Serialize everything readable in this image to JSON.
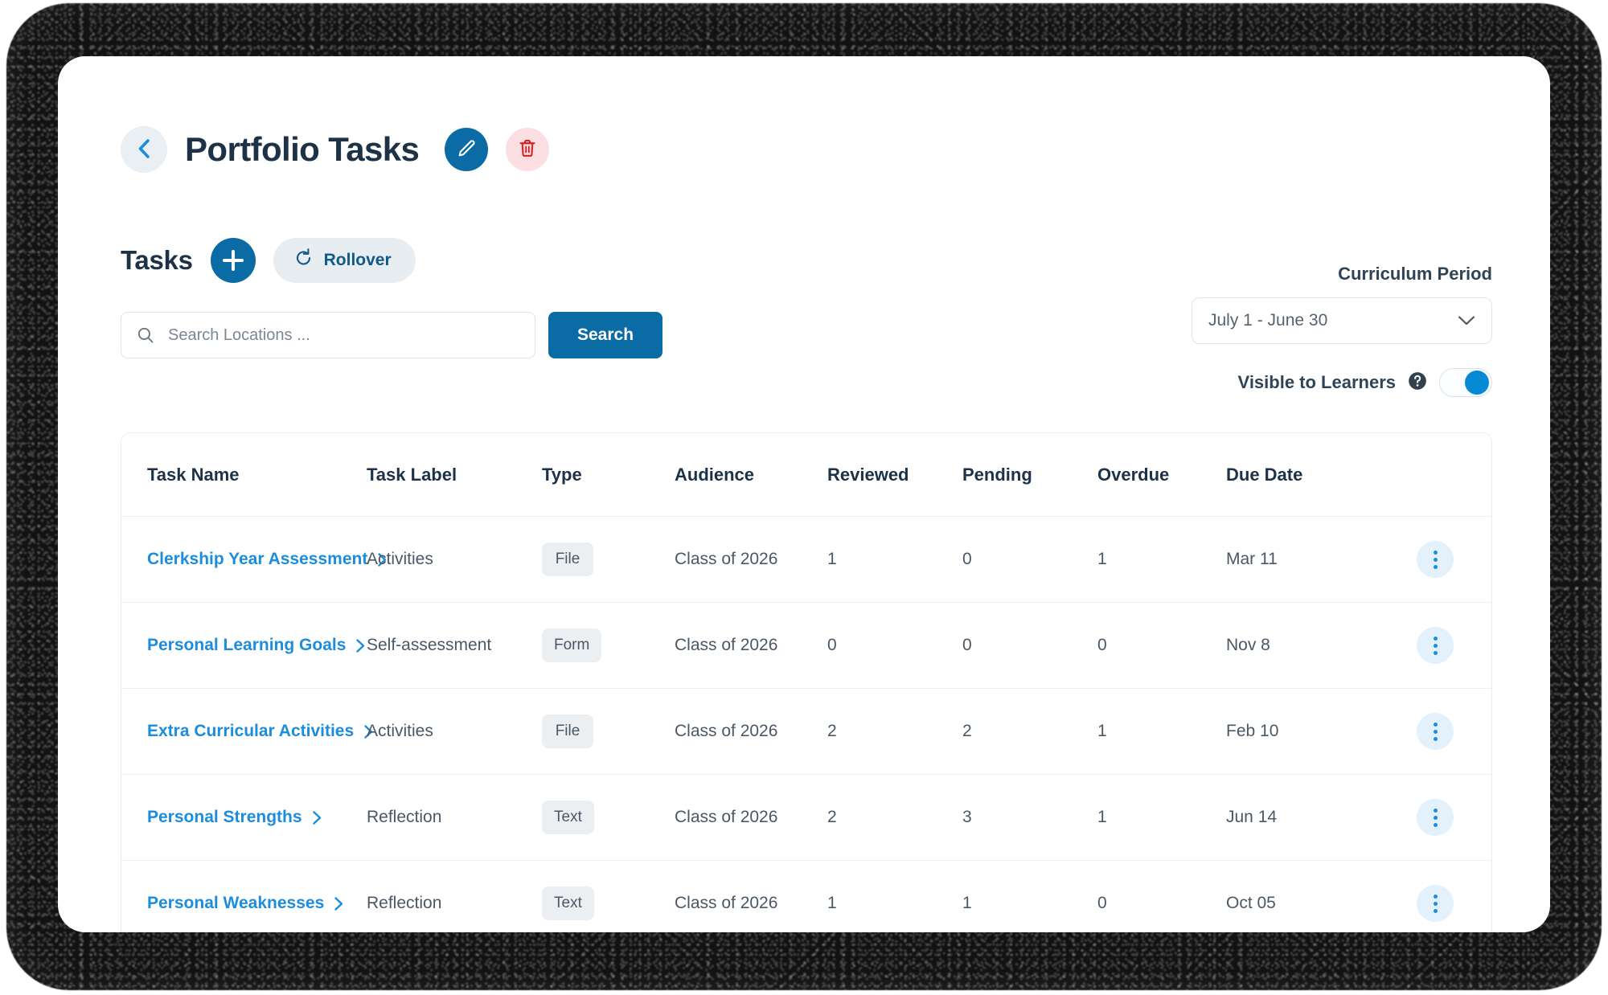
{
  "header": {
    "title": "Portfolio Tasks",
    "back_icon": "chevron-left-icon",
    "edit_icon": "pencil-icon",
    "delete_icon": "trash-icon"
  },
  "tasks_bar": {
    "heading": "Tasks",
    "add_icon": "plus-icon",
    "rollover_label": "Rollover",
    "rollover_icon": "refresh-icon"
  },
  "search": {
    "placeholder": "Search Locations ...",
    "value": "",
    "button_label": "Search",
    "icon": "search-icon"
  },
  "curriculum": {
    "label": "Curriculum Period",
    "selected": "July 1 - June 30",
    "chevron_icon": "chevron-down-icon",
    "options": [
      "July 1 - June 30"
    ]
  },
  "visibility": {
    "label": "Visible to Learners",
    "help_icon": "help-circle-icon",
    "enabled": true
  },
  "colors": {
    "primary_blue": "#0a6ba5",
    "link_blue": "#1c8ddc",
    "toggle_on": "#068ad6",
    "danger_red": "#e5181c",
    "danger_bg": "#fbdfe2",
    "heading_navy": "#1d3246",
    "kebab_bg": "#e2f1fc"
  },
  "table": {
    "columns": [
      "Task Name",
      "Task Label",
      "Type",
      "Audience",
      "Reviewed",
      "Pending",
      "Overdue",
      "Due Date"
    ],
    "rows": [
      {
        "name": "Clerkship Year Assessment",
        "label": "Activities",
        "type": "File",
        "audience": "Class of 2026",
        "reviewed": "1",
        "pending": "0",
        "overdue": "1",
        "due_date": "Mar 11"
      },
      {
        "name": "Personal Learning Goals",
        "label": "Self-assessment",
        "type": "Form",
        "audience": "Class of 2026",
        "reviewed": "0",
        "pending": "0",
        "overdue": "0",
        "due_date": "Nov 8"
      },
      {
        "name": "Extra Curricular Activities",
        "label": "Activities",
        "type": "File",
        "audience": "Class of 2026",
        "reviewed": "2",
        "pending": "2",
        "overdue": "1",
        "due_date": "Feb 10"
      },
      {
        "name": "Personal Strengths",
        "label": "Reflection",
        "type": "Text",
        "audience": "Class of 2026",
        "reviewed": "2",
        "pending": "3",
        "overdue": "1",
        "due_date": "Jun 14"
      },
      {
        "name": "Personal Weaknesses",
        "label": "Reflection",
        "type": "Text",
        "audience": "Class of 2026",
        "reviewed": "1",
        "pending": "1",
        "overdue": "0",
        "due_date": "Oct 05"
      }
    ],
    "row_menu_icon": "kebab-menu-icon"
  }
}
